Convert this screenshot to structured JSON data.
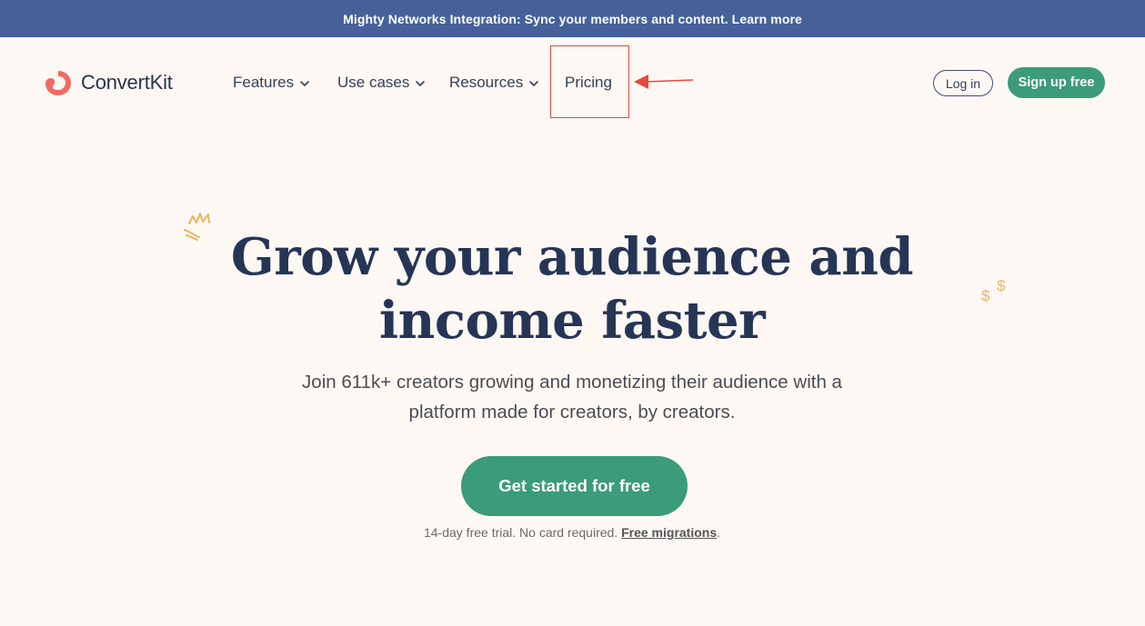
{
  "announcement": {
    "text": "Mighty Networks Integration: Sync your members and content. Learn more"
  },
  "header": {
    "logo_text": "ConvertKit",
    "nav": [
      {
        "label": "Features",
        "icon": "chevron-down-icon"
      },
      {
        "label": "Use cases",
        "icon": "chevron-down-icon"
      },
      {
        "label": "Resources",
        "icon": "chevron-down-icon"
      },
      {
        "label": "Pricing"
      }
    ],
    "login_label": "Log in",
    "signup_label": "Sign up free"
  },
  "hero": {
    "headline_line1": "Grow your audience and",
    "headline_line2": "income faster",
    "subhead_line1": "Join 611k+ creators growing and monetizing their audience with a",
    "subhead_line2": "platform made for creators, by creators.",
    "cta_label": "Get started for free",
    "fineprint_text": "14-day free trial. No card required.",
    "fineprint_link": "Free migrations",
    "fineprint_end": "."
  },
  "colors": {
    "announcement_bg": "#46619a",
    "page_bg": "#fdf8f3",
    "brand_green": "#3b9b7a",
    "logo_red": "#f26a63",
    "heading_navy": "#263556",
    "annotation_red": "#e24a40",
    "doodle_gold": "#e8b566"
  },
  "icons": [
    "logo-icon",
    "chevron-down-icon",
    "annotation-arrow-icon",
    "crown-doodle-icon",
    "dollar-doodle-icon"
  ]
}
